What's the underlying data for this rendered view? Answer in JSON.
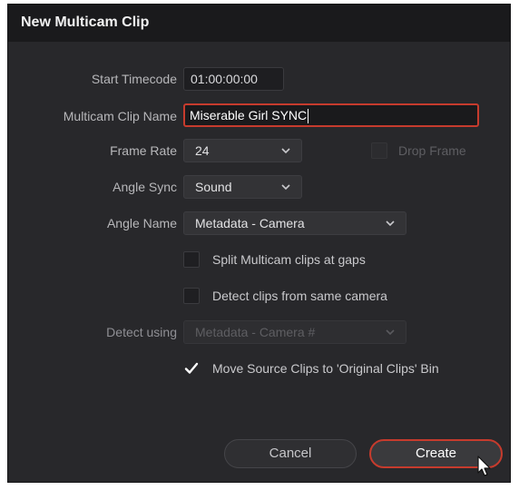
{
  "dialog": {
    "title": "New Multicam Clip"
  },
  "fields": {
    "start_timecode": {
      "label": "Start Timecode",
      "value": "01:00:00:00"
    },
    "clip_name": {
      "label": "Multicam Clip Name",
      "value": "Miserable Girl SYNC"
    },
    "frame_rate": {
      "label": "Frame Rate",
      "value": "24"
    },
    "drop_frame": {
      "label": "Drop Frame",
      "checked": false,
      "enabled": false
    },
    "angle_sync": {
      "label": "Angle Sync",
      "value": "Sound"
    },
    "angle_name": {
      "label": "Angle Name",
      "value": "Metadata - Camera"
    },
    "split_gaps": {
      "label": "Split Multicam clips at gaps",
      "checked": false
    },
    "detect_same_camera": {
      "label": "Detect clips from same camera",
      "checked": false
    },
    "detect_using": {
      "label": "Detect using",
      "value": "Metadata - Camera #",
      "enabled": false
    },
    "move_source": {
      "label": "Move Source Clips to 'Original Clips' Bin",
      "checked": true
    }
  },
  "buttons": {
    "cancel": "Cancel",
    "create": "Create"
  },
  "colors": {
    "accent": "#c63b2d",
    "background": "#28282b",
    "titlebar": "#1a1a1c"
  }
}
